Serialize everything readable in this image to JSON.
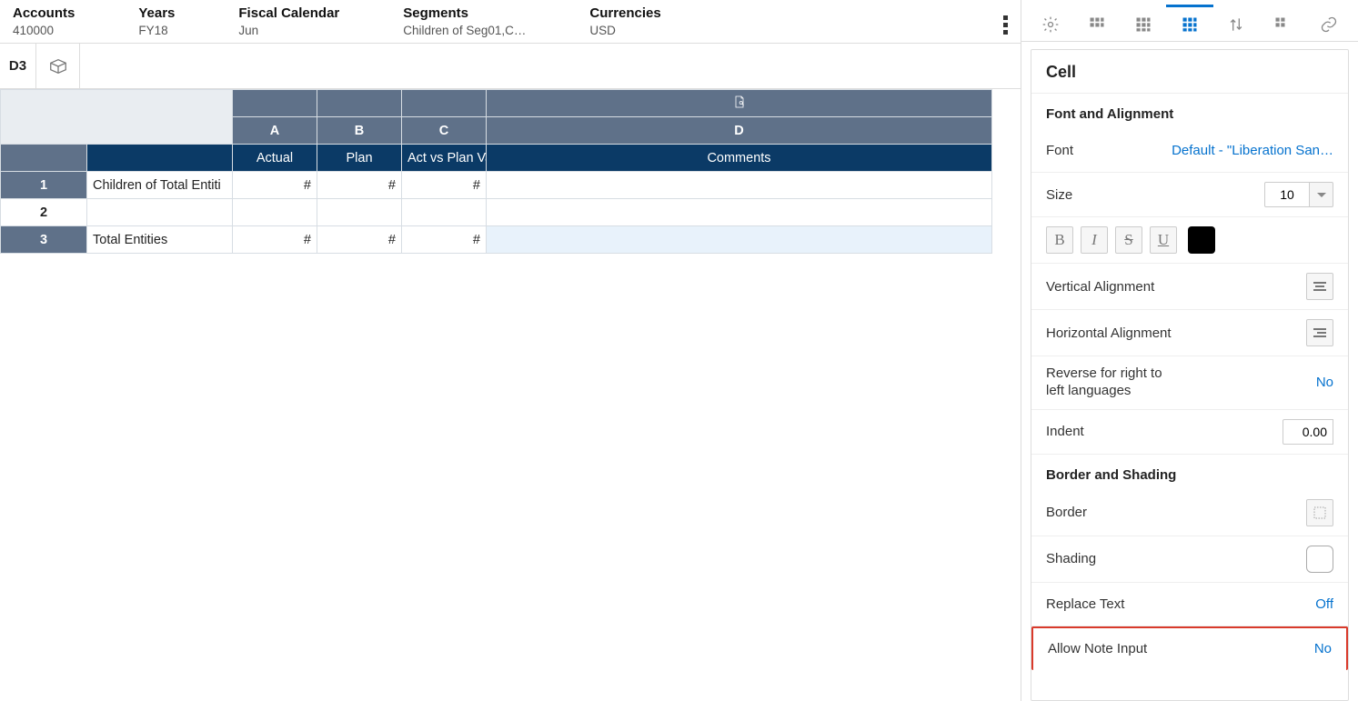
{
  "pov": {
    "accounts": {
      "label": "Accounts",
      "value": "410000"
    },
    "years": {
      "label": "Years",
      "value": "FY18"
    },
    "fiscal": {
      "label": "Fiscal Calendar",
      "value": "Jun"
    },
    "segments": {
      "label": "Segments",
      "value": "Children of Seg01,C…"
    },
    "currencies": {
      "label": "Currencies",
      "value": "USD"
    }
  },
  "cellref": "D3",
  "grid": {
    "colLetters": [
      "A",
      "B",
      "C",
      "D"
    ],
    "fieldHeaders": [
      "Actual",
      "Plan",
      "Act vs Plan Va",
      "Comments"
    ],
    "rows": [
      {
        "num": "1",
        "label": "Children of Total Entiti",
        "a": "#",
        "b": "#",
        "c": "#",
        "d": "",
        "numbg": "dark"
      },
      {
        "num": "2",
        "label": "",
        "a": "",
        "b": "",
        "c": "",
        "d": "",
        "numbg": "light"
      },
      {
        "num": "3",
        "label": "Total Entities",
        "a": "#",
        "b": "#",
        "c": "#",
        "d": "",
        "numbg": "dark",
        "selected": true
      }
    ]
  },
  "sidebar": {
    "title": "Cell",
    "sect1": "Font and Alignment",
    "font": {
      "label": "Font",
      "value": "Default - \"Liberation San…"
    },
    "size": {
      "label": "Size",
      "value": "10"
    },
    "valign": {
      "label": "Vertical Alignment"
    },
    "halign": {
      "label": "Horizontal Alignment"
    },
    "rtl": {
      "label": "Reverse for right to\nleft languages",
      "value": "No"
    },
    "indent": {
      "label": "Indent",
      "value": "0.00"
    },
    "sect2": "Border and Shading",
    "border": {
      "label": "Border"
    },
    "shade": {
      "label": "Shading"
    },
    "replace": {
      "label": "Replace Text",
      "value": "Off"
    },
    "allownote": {
      "label": "Allow Note Input",
      "value": "No"
    }
  },
  "icons": {
    "gear": "gear-icon",
    "grid1": "grid-icon",
    "grid2": "grid-icon",
    "grid3": "grid-icon",
    "sort": "sort-icon",
    "grid4": "grid-icon",
    "link": "link-icon"
  }
}
